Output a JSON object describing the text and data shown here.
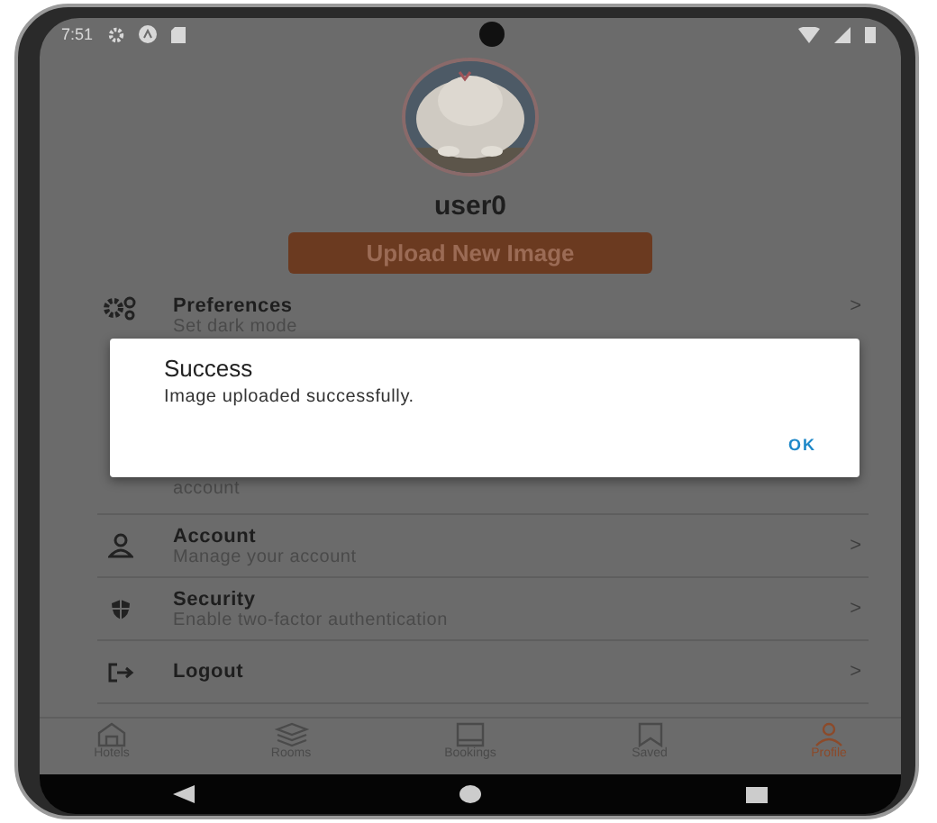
{
  "status_bar": {
    "time": "7:51"
  },
  "profile": {
    "username": "user0",
    "upload_button": "Upload New Image"
  },
  "menu": [
    {
      "kind": "preferences",
      "title": "Preferences",
      "subtitle": "Set dark mode",
      "chevron": ">"
    },
    {
      "kind": "hidden",
      "subtitle": "account"
    },
    {
      "kind": "account",
      "title": "Account",
      "subtitle": "Manage your account",
      "chevron": ">"
    },
    {
      "kind": "security",
      "title": "Security",
      "subtitle": "Enable two-factor authentication",
      "chevron": ">"
    },
    {
      "kind": "logout",
      "title": "Logout",
      "chevron": ">"
    }
  ],
  "dialog": {
    "title": "Success",
    "message": "Image uploaded successfully.",
    "button": "OK"
  },
  "tabs": [
    {
      "kind": "hotels",
      "label": "Hotels",
      "selected": false
    },
    {
      "kind": "rooms",
      "label": "Rooms",
      "selected": false
    },
    {
      "kind": "bookings",
      "label": "Bookings",
      "selected": false
    },
    {
      "kind": "saved",
      "label": "Saved",
      "selected": false
    },
    {
      "kind": "profile",
      "label": "Profile",
      "selected": true
    }
  ]
}
